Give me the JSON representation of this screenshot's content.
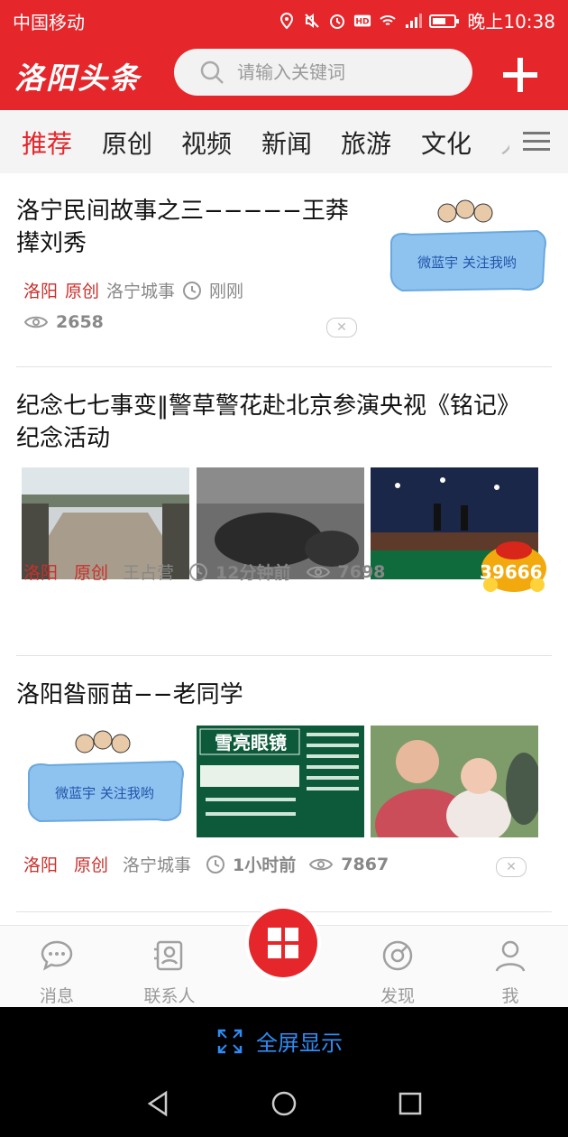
{
  "status_bar": {
    "carrier": "中国移动",
    "time": "晚上10:38",
    "icons": [
      "location-icon",
      "mute-icon",
      "alarm-icon",
      "hd-icon",
      "wifi-icon",
      "signal-icon",
      "battery-icon"
    ]
  },
  "header": {
    "logo": "洛阳头条",
    "search_placeholder": "请输入关键词",
    "add_icon": "plus-icon"
  },
  "tabs": {
    "items": [
      "推荐",
      "原创",
      "视频",
      "新闻",
      "旅游",
      "文化",
      "人"
    ],
    "active": "推荐"
  },
  "articles": [
    {
      "title": "洛宁民间故事之三−−−−−王莽撵刘秀",
      "source": "洛阳",
      "tag": "原创",
      "category": "洛宁城事",
      "time": "刚刚",
      "views": "2658",
      "thumb_text": "微蓝宇 关注我哟"
    },
    {
      "title": "纪念七七事变‖警草警花赴北京参演央视《铭记》纪念活动",
      "source": "洛阳",
      "tag": "原创",
      "category": "王占营",
      "time": "12分钟前",
      "views": "7698",
      "badge": "39666"
    },
    {
      "title": "洛阳昝丽苗−−老同学",
      "source": "洛阳",
      "tag": "原创",
      "category": "洛宁城事",
      "time": "1小时前",
      "views": "7867",
      "thumb_text": "微蓝宇 关注我哟",
      "ad_title": "雪亮眼镜"
    }
  ],
  "bottom_nav": {
    "items": [
      "消息",
      "联系人",
      "",
      "发现",
      "我"
    ]
  },
  "fullscreen": {
    "label": "全屏显示"
  },
  "colors": {
    "brand_red": "#e5262b",
    "link_blue": "#2f8cf5"
  }
}
